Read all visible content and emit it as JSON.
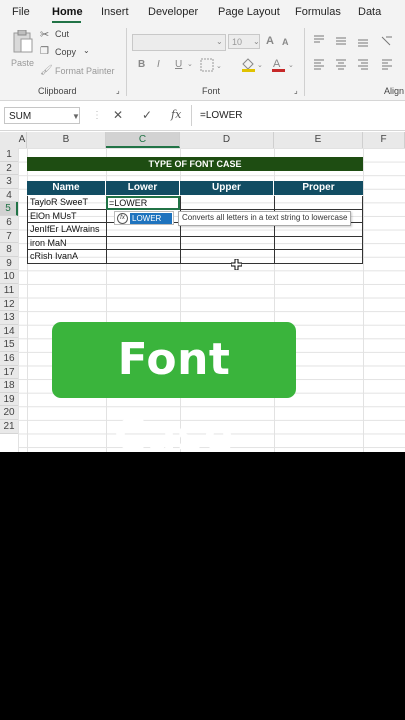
{
  "ribbon": {
    "tabs": [
      "File",
      "Home",
      "Insert",
      "Developer",
      "Page Layout",
      "Formulas",
      "Data"
    ],
    "active_tab": "Home",
    "clipboard": {
      "paste_label": "Paste",
      "cut_label": "Cut",
      "copy_label": "Copy",
      "format_painter_label": "Format Painter",
      "group_label": "Clipboard"
    },
    "font": {
      "size_value": "10",
      "group_label": "Font",
      "bold": "B",
      "italic": "I",
      "underline": "U"
    },
    "alignment": {
      "group_label": "Align"
    }
  },
  "formula_bar": {
    "name_box": "SUM",
    "cancel_icon": "✕",
    "enter_icon": "✓",
    "fx_label": "fx",
    "formula": "=LOWER"
  },
  "sheet": {
    "columns": [
      "A",
      "B",
      "C",
      "D",
      "E",
      "F"
    ],
    "selected_column": "C",
    "rows": [
      "1",
      "2",
      "3",
      "4",
      "5",
      "6",
      "7",
      "8",
      "9",
      "10",
      "11",
      "12",
      "13",
      "14",
      "15",
      "16",
      "17",
      "18",
      "19",
      "20",
      "21"
    ],
    "selected_row": "5",
    "title": "TYPE OF FONT CASE",
    "table_headers": [
      "Name",
      "Lower",
      "Upper",
      "Proper"
    ],
    "names": [
      "TayloR SweeT",
      "ElOn MUsT",
      "JenIfEr LAWrains",
      "iron MaN",
      "cRish IvanA"
    ],
    "active_cell_text": "=LOWER",
    "autocomplete_item": "LOWER",
    "tooltip": "Converts all letters in a text string to lowercase"
  },
  "banner": {
    "text": "Font Case"
  },
  "colors": {
    "excel_green": "#217346",
    "title_fill": "#1e4d12",
    "header_fill": "#124d63",
    "banner_fill": "#3ab43c"
  }
}
